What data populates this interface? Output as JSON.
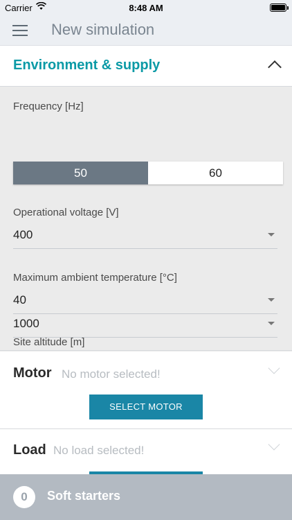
{
  "status_bar": {
    "carrier": "Carrier",
    "time": "8:48 AM"
  },
  "nav": {
    "title": "New simulation",
    "menu_icon": "hamburger-menu-icon"
  },
  "environment": {
    "title": "Environment & supply",
    "frequency": {
      "label": "Frequency [Hz]",
      "options": [
        "50",
        "60"
      ],
      "selected": "50"
    },
    "voltage": {
      "label": "Operational voltage [V]",
      "value": "400"
    },
    "temperature": {
      "label": "Maximum ambient temperature [°C]",
      "value": "40"
    },
    "altitude": {
      "label": "Site altitude [m]",
      "value": "1000"
    }
  },
  "motor": {
    "title": "Motor",
    "status": "No motor selected!",
    "button": "SELECT MOTOR"
  },
  "load": {
    "title": "Load",
    "status": "No load selected!"
  },
  "footer": {
    "count": "0",
    "title": "Soft starters"
  },
  "colors": {
    "accent": "#0b9aa6",
    "button": "#1a86a6",
    "segment_active": "#6b7884",
    "footer": "#b3bac2"
  }
}
